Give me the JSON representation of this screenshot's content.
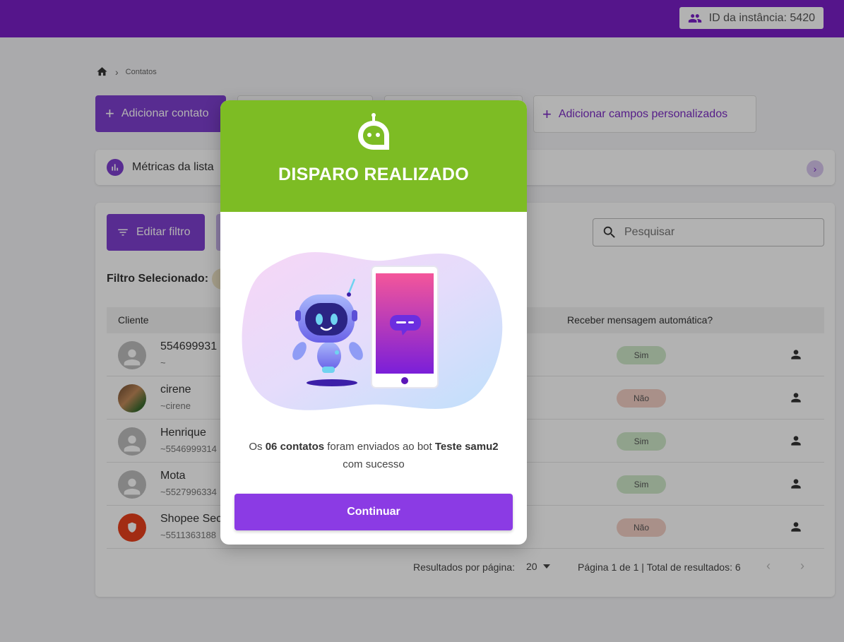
{
  "topbar": {
    "instance_label": "ID da instância: 5420"
  },
  "breadcrumb": {
    "current": "Contatos"
  },
  "toolbar": {
    "add_contact": "Adicionar contato",
    "add_custom_fields": "Adicionar campos personalizados"
  },
  "metrics": {
    "label": "Métricas da lista"
  },
  "panel": {
    "edit_filter": "Editar filtro",
    "search_placeholder": "Pesquisar",
    "filter_label": "Filtro Selecionado:"
  },
  "table": {
    "headers": {
      "client": "Cliente",
      "auto_message": "Receber mensagem automática?"
    },
    "rows": [
      {
        "name": "554699931",
        "sub": "~",
        "status": "Sim"
      },
      {
        "name": "cirene",
        "sub": "~cirene",
        "status": "Não"
      },
      {
        "name": "Henrique",
        "sub": "~5546999314",
        "status": "Sim"
      },
      {
        "name": "Mota",
        "sub": "~5527996334",
        "status": "Sim"
      },
      {
        "name": "Shopee Sec",
        "sub": "~5511363188",
        "status": "Não"
      }
    ]
  },
  "pagination": {
    "per_page_label": "Resultados por página:",
    "per_page_value": "20",
    "info": "Página 1 de 1 | Total de resultados: 6"
  },
  "modal": {
    "title": "DISPARO REALIZADO",
    "msg_prefix": "Os ",
    "msg_count": "06 contatos",
    "msg_middle": " foram enviados ao bot ",
    "msg_bot": "Teste samu2",
    "msg_suffix": "com sucesso",
    "button": "Continuar"
  },
  "colors": {
    "brand_purple": "#7a1fc7",
    "button_purple": "#8b3be4",
    "success_green": "#7dbc24",
    "badge_yes": "#cfe9c9",
    "badge_no": "#f3cfc4"
  }
}
